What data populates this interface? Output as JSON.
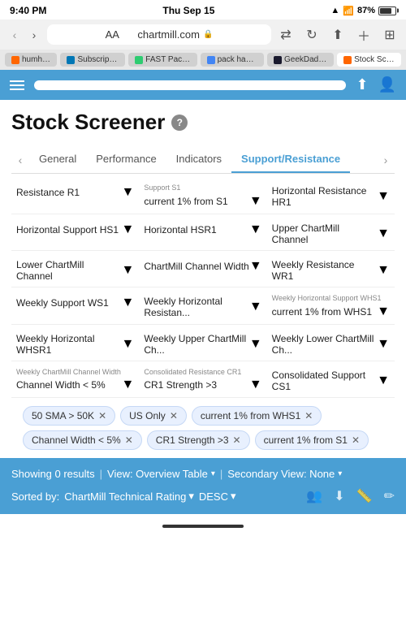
{
  "status_bar": {
    "time": "9:40 PM",
    "date": "Thu Sep 15",
    "battery": "87%"
  },
  "browser": {
    "url": "chartmill.com",
    "aa_label": "AA",
    "back_arrow": "‹",
    "forward_arrow": "›",
    "tabs": [
      {
        "id": "hh",
        "label": "humhub-b",
        "favicon_class": "hh"
      },
      {
        "id": "sub",
        "label": "Subscription...",
        "favicon_class": "sub"
      },
      {
        "id": "fp",
        "label": "FAST Pack Li...",
        "favicon_class": "fp"
      },
      {
        "id": "g",
        "label": "pack hacker...",
        "favicon_class": "g"
      },
      {
        "id": "wt",
        "label": "GeekDad Re...",
        "favicon_class": "wt"
      },
      {
        "id": "active",
        "label": "Stock Scree...",
        "favicon_class": "hh",
        "active": true
      }
    ]
  },
  "header": {
    "search_placeholder": "",
    "share_icon": "⬆",
    "person_icon": "👤"
  },
  "page": {
    "title": "Stock Screener",
    "help_icon": "?"
  },
  "category_tabs": {
    "left_arrow": "‹",
    "right_arrow": "›",
    "tabs": [
      {
        "id": "general",
        "label": "General",
        "active": false
      },
      {
        "id": "performance",
        "label": "Performance",
        "active": false
      },
      {
        "id": "indicators",
        "label": "Indicators",
        "active": false
      },
      {
        "id": "support",
        "label": "Support/Resistance",
        "active": true
      }
    ]
  },
  "filters": [
    {
      "id": "r1",
      "label": "",
      "value": "Resistance R1"
    },
    {
      "id": "s1",
      "label": "Support S1",
      "value": "current 1% from S1"
    },
    {
      "id": "hr1",
      "label": "",
      "value": "Horizontal Resistance HR1"
    },
    {
      "id": "hs1",
      "label": "",
      "value": "Horizontal Support HS1"
    },
    {
      "id": "hsr1",
      "label": "",
      "value": "Horizontal HSR1"
    },
    {
      "id": "upper",
      "label": "",
      "value": "Upper ChartMill Channel"
    },
    {
      "id": "lower",
      "label": "",
      "value": "Lower ChartMill Channel"
    },
    {
      "id": "cw",
      "label": "",
      "value": "ChartMill Channel Width"
    },
    {
      "id": "wr1",
      "label": "",
      "value": "Weekly Resistance WR1"
    },
    {
      "id": "ws1",
      "label": "",
      "value": "Weekly Support WS1"
    },
    {
      "id": "whr",
      "label": "",
      "value": "Weekly Horizontal Resistan..."
    },
    {
      "id": "whs1",
      "label": "Weekly Horizontal Support WHS1",
      "value": "current 1% from WHS1"
    },
    {
      "id": "whsr1",
      "label": "",
      "value": "Weekly Horizontal WHSR1"
    },
    {
      "id": "wupper",
      "label": "",
      "value": "Weekly Upper ChartMill Ch..."
    },
    {
      "id": "wlower",
      "label": "",
      "value": "Weekly Lower ChartMill Ch..."
    },
    {
      "id": "wcw",
      "label": "Weekly ChartMill Channel Width",
      "value": "Channel Width < 5%"
    },
    {
      "id": "cr1",
      "label": "Consolidated Resistance CR1",
      "value": "CR1 Strength >3"
    },
    {
      "id": "cs1",
      "label": "",
      "value": "Consolidated Support CS1"
    }
  ],
  "active_tags": [
    {
      "id": "tag1",
      "label": "50 SMA > 50K"
    },
    {
      "id": "tag2",
      "label": "US Only"
    },
    {
      "id": "tag3",
      "label": "current 1% from WHS1"
    },
    {
      "id": "tag4",
      "label": "Channel Width < 5%"
    },
    {
      "id": "tag5",
      "label": "CR1 Strength >3"
    },
    {
      "id": "tag6",
      "label": "current 1% from S1"
    }
  ],
  "results": {
    "count_label": "Showing 0 results",
    "view_label": "View: Overview Table",
    "secondary_label": "Secondary View: None",
    "sort_prefix": "Sorted by:",
    "sort_field": "ChartMill Technical Rating",
    "sort_direction": "DESC",
    "dropdown_arrow": "▾"
  },
  "icons": {
    "person_icon": "👤",
    "download_icon": "⬇",
    "pencil_icon": "✏",
    "list_icon": "≡"
  }
}
